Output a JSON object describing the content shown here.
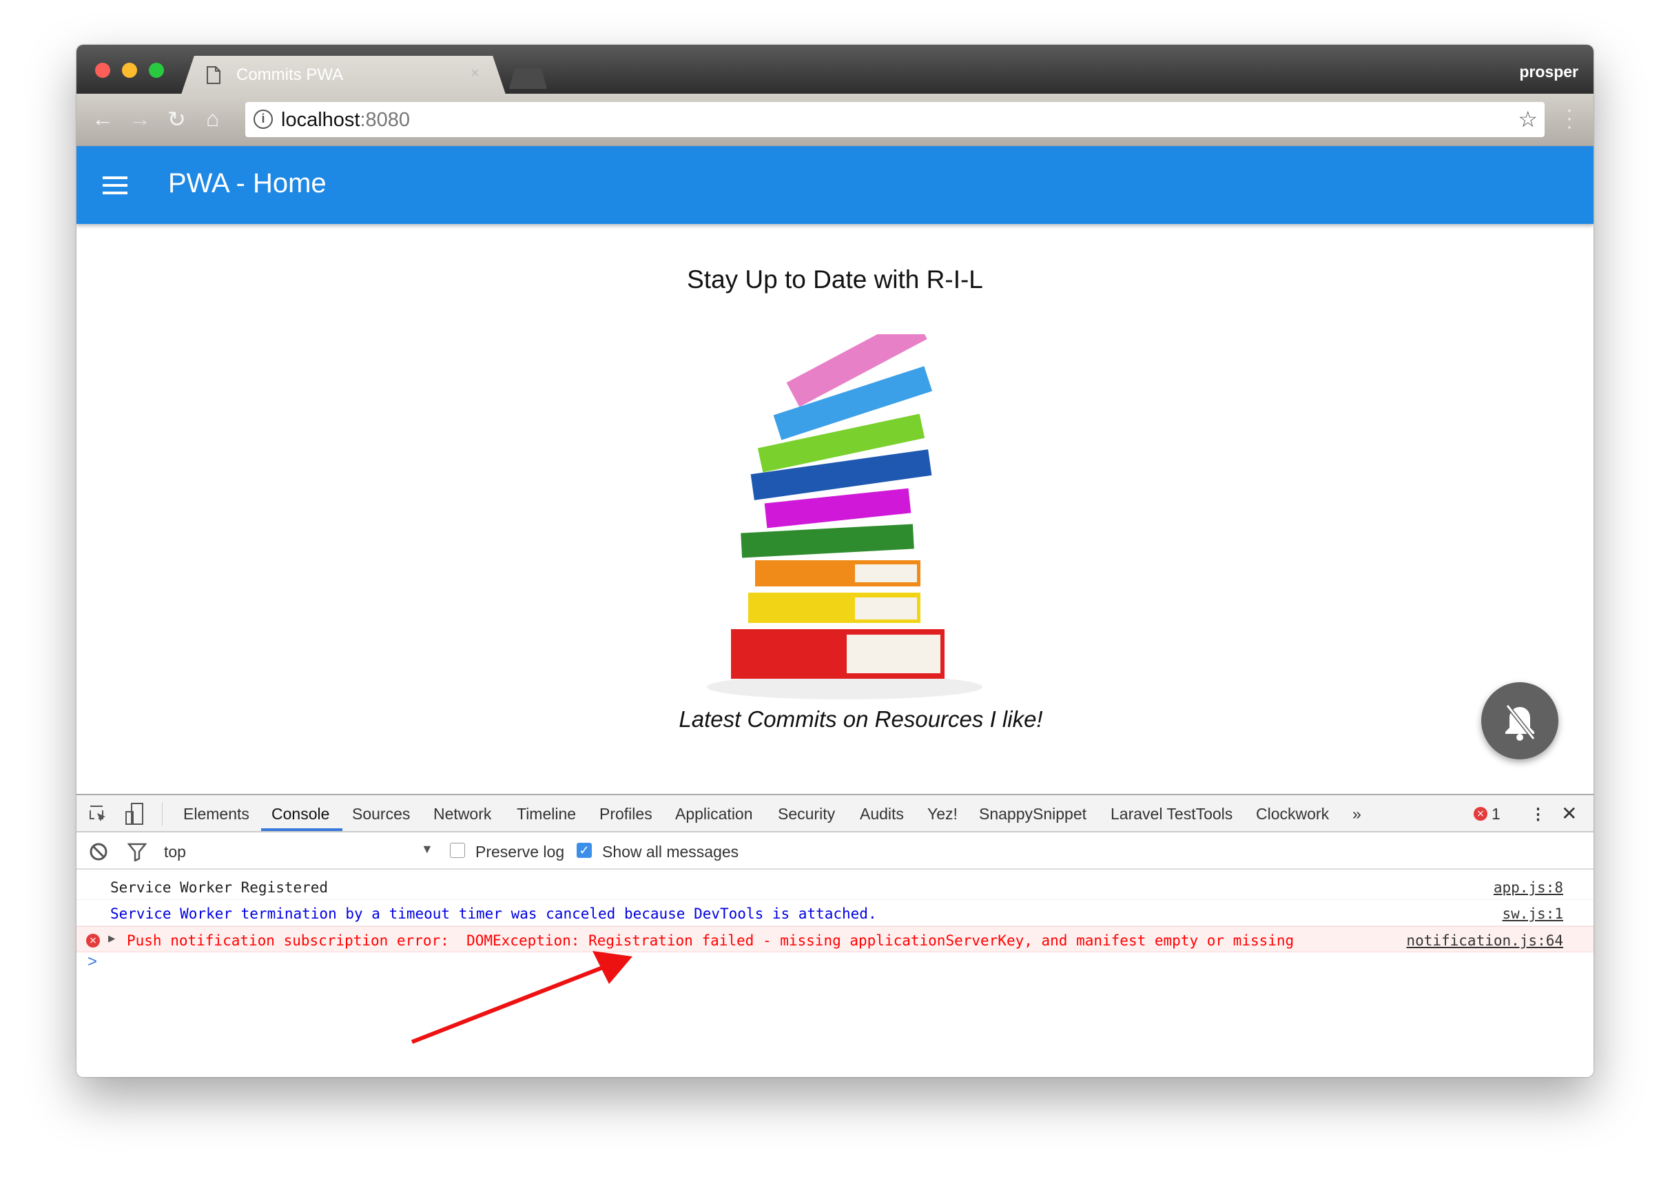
{
  "browser": {
    "tab_title": "Commits PWA",
    "profile_name": "prosper",
    "url_host": "localhost",
    "url_port": ":8080"
  },
  "app": {
    "title": "PWA - Home",
    "heading": "Stay Up to Date with R-I-L",
    "subtitle": "Latest Commits on Resources I like!",
    "fab_icon": "notifications-off-icon",
    "brand_color": "#1e88e5"
  },
  "devtools": {
    "tabs": [
      "Elements",
      "Console",
      "Sources",
      "Network",
      "Timeline",
      "Profiles",
      "Application",
      "Security",
      "Audits",
      "Yez!",
      "SnappySnippet",
      "Laravel TestTools",
      "Clockwork"
    ],
    "active_tab": "Console",
    "more_tabs": "»",
    "error_count": "1",
    "context": "top",
    "preserve_log": {
      "label": "Preserve log",
      "checked": false
    },
    "show_all": {
      "label": "Show all messages",
      "checked": true
    },
    "console": [
      {
        "text": "Service Worker Registered",
        "source": "app.js:8",
        "level": "log"
      },
      {
        "text": "Service Worker termination by a timeout timer was canceled because DevTools is attached.",
        "source": "sw.js:1",
        "level": "info"
      },
      {
        "text": "Push notification subscription error:  DOMException: Registration failed - missing applicationServerKey, and manifest empty or missing",
        "source": "notification.js:64",
        "level": "error"
      }
    ],
    "prompt": ">"
  },
  "annotation": {
    "arrow_color": "#ee1111"
  }
}
